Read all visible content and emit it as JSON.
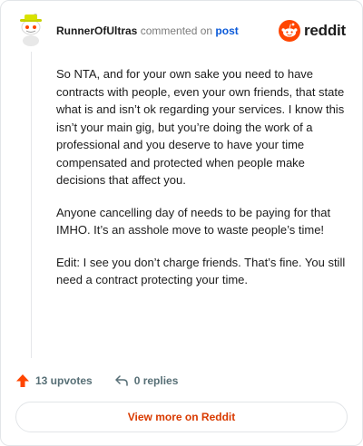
{
  "header": {
    "username": "RunnerOfUltras",
    "action_text": "commented on",
    "post_link": "post",
    "brand": "reddit"
  },
  "comment": {
    "paragraphs": [
      "So NTA, and for your own sake you need to have contracts with people, even your own friends, that state what is and isn’t ok regarding your services. I know this isn’t your main gig, but you’re doing the work of a professional and you deserve to have your time compensated and protected when people make decisions that affect you.",
      "Anyone cancelling day of needs to be paying for that IMHO. It’s an asshole move to waste people’s time!",
      "Edit: I see you don’t charge friends. That’s fine. You still need a contract protecting your time."
    ]
  },
  "actions": {
    "upvotes": "13 upvotes",
    "replies": "0 replies"
  },
  "footer": {
    "view_more": "View more on Reddit"
  },
  "colors": {
    "accent": "#ff4500",
    "link": "#0b5ad9",
    "view_more": "#d93a00"
  }
}
